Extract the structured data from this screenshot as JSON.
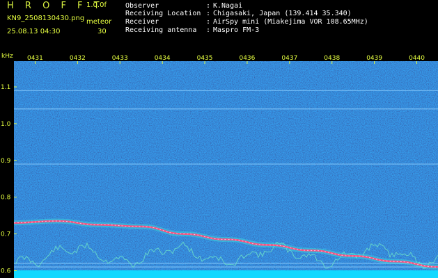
{
  "header": {
    "brand": "H R O F F T",
    "version": "1.0.0f",
    "filename": "KN9_2508130430.png",
    "unit_label": "meteor",
    "timestamp": "25.08.13 04:30",
    "unit_value": "30",
    "fields": [
      {
        "label": "Observer",
        "value": "K.Nagai"
      },
      {
        "label": "Receiving Location",
        "value": "Chigasaki, Japan (139.414 35.340)"
      },
      {
        "label": "Receiver",
        "value": "AirSpy mini (Miakejima VOR 108.65MHz)"
      },
      {
        "label": "Receiving antenna",
        "value": "Maspro FM-3"
      }
    ]
  },
  "colors": {
    "background": "#0a1a6e",
    "label_yellow": "#e6ff40",
    "noise_cyan": "#00e8ff",
    "trace_red": "#ff3a5a"
  },
  "chart_data": {
    "type": "heatmap",
    "title": "",
    "ylabel": "kHz",
    "xlabel": "",
    "x_ticks": [
      "0431",
      "0432",
      "0433",
      "0434",
      "0435",
      "0436",
      "0437",
      "0438",
      "0439",
      "0440"
    ],
    "y_ticks": [
      "1.1",
      "1.0",
      "0.9",
      "0.8",
      "0.7",
      "0.6"
    ],
    "ylim": [
      0.58,
      1.17
    ],
    "xlim_minutes": [
      0,
      10
    ],
    "horizontal_lines_khz": [
      1.09,
      1.04,
      0.89,
      0.62,
      0.61
    ],
    "carrier_trace": {
      "minutes": [
        0,
        1,
        2,
        3,
        4,
        5,
        6,
        7,
        8,
        9,
        10
      ],
      "khz": [
        0.73,
        0.735,
        0.725,
        0.72,
        0.7,
        0.685,
        0.67,
        0.655,
        0.64,
        0.625,
        0.61
      ]
    }
  }
}
